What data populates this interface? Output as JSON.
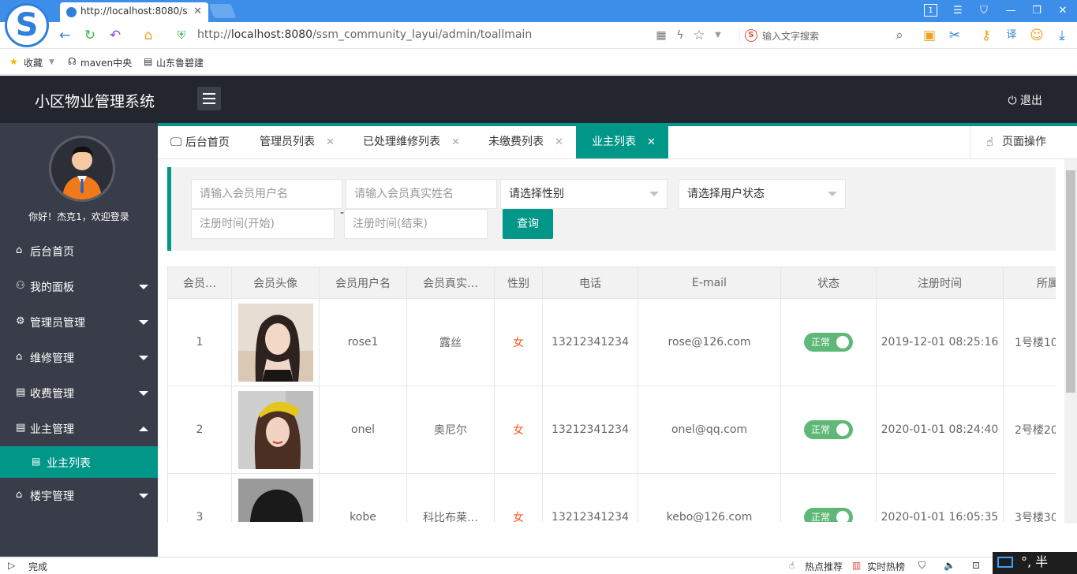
{
  "browser": {
    "tab_title": "http://localhost:8080/s",
    "url_prefix": "http://",
    "url_host": "localhost:8080",
    "url_path": "/ssm_community_layui/admin/toallmain",
    "search_placeholder": "输入文字搜索",
    "bookmarks": [
      "收藏",
      "maven中央",
      "山东鲁碧建"
    ],
    "status_left": "完成",
    "status_hot": "热点推荐",
    "status_rank": "实时热榜",
    "ime_text": "°, 半"
  },
  "app": {
    "title": "小区物业管理系统",
    "logout_label": "退出"
  },
  "sidebar": {
    "welcome": "你好！杰克1，欢迎登录",
    "items": [
      {
        "label": "后台首页",
        "icon": "home-icon"
      },
      {
        "label": "我的面板",
        "icon": "user-icon"
      },
      {
        "label": "管理员管理",
        "icon": "gear-icon"
      },
      {
        "label": "维修管理",
        "icon": "home-icon"
      },
      {
        "label": "收费管理",
        "icon": "doc-icon"
      },
      {
        "label": "业主管理",
        "icon": "doc-icon"
      },
      {
        "label": "楼宇管理",
        "icon": "home-icon"
      }
    ],
    "sub_item": "业主列表"
  },
  "tabs": [
    {
      "label": "后台首页"
    },
    {
      "label": "管理员列表"
    },
    {
      "label": "已处理维修列表"
    },
    {
      "label": "未缴费列表"
    },
    {
      "label": "业主列表"
    }
  ],
  "page_ops_label": "页面操作",
  "search": {
    "username_placeholder": "请输入会员用户名",
    "realname_placeholder": "请输入会员真实姓名",
    "gender_select": "请选择性别",
    "status_select": "请选择用户状态",
    "start_placeholder": "注册时间(开始)",
    "end_placeholder": "注册时间(结束)",
    "dash": "-",
    "query_label": "查询"
  },
  "table": {
    "headers": [
      "会员…",
      "会员头像",
      "会员用户名",
      "会员真实…",
      "性别",
      "电话",
      "E-mail",
      "状态",
      "注册时间",
      "所属房间"
    ],
    "rows": [
      {
        "id": "1",
        "username": "rose1",
        "realname": "露丝",
        "sex": "女",
        "phone": "13212341234",
        "email": "rose@126.com",
        "status": "正常",
        "reg_time": "2019-12-01 08:25:16",
        "room": "1号楼10"
      },
      {
        "id": "2",
        "username": "onel",
        "realname": "奥尼尔",
        "sex": "女",
        "phone": "13212341234",
        "email": "onel@qq.com",
        "status": "正常",
        "reg_time": "2020-01-01 08:24:40",
        "room": "2号楼20"
      },
      {
        "id": "3",
        "username": "kobe",
        "realname": "科比布莱…",
        "sex": "女",
        "phone": "13212341234",
        "email": "kebo@126.com",
        "status": "正常",
        "reg_time": "2020-01-01 16:05:35",
        "room": "3号楼30"
      }
    ]
  },
  "colors": {
    "accent": "#009688",
    "header_bg": "#23262e",
    "sidebar_bg": "#393d49",
    "switch_on": "#5fb878",
    "sex_color": "#ff5722"
  }
}
